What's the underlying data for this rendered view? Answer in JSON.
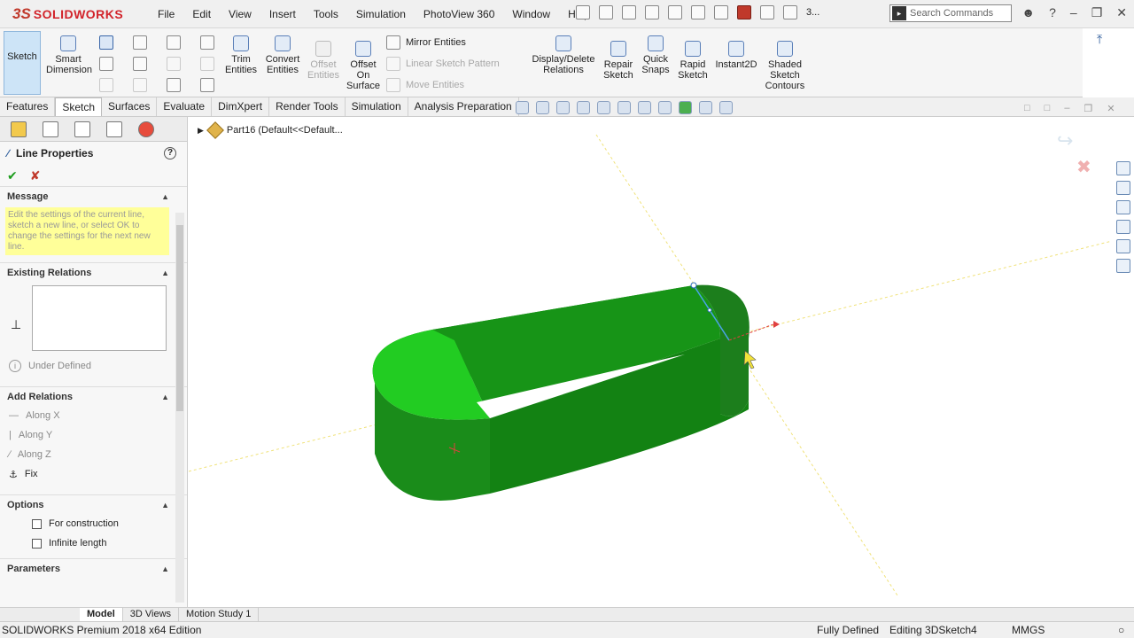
{
  "app": {
    "logo_text": "SOLIDWORKS",
    "menu": [
      "File",
      "Edit",
      "View",
      "Insert",
      "Tools",
      "Simulation",
      "PhotoView 360",
      "Window",
      "Help"
    ],
    "search_placeholder": "Search Commands",
    "toolbar_more": "3..."
  },
  "ribbon": {
    "sketch": "Sketch",
    "smart_dimension": "Smart Dimension",
    "trim_entities": "Trim Entities",
    "convert_entities": "Convert Entities",
    "offset_entities": "Offset Entities",
    "offset_on_surface": "Offset On Surface",
    "mirror_entities": "Mirror Entities",
    "linear_sketch_pattern": "Linear Sketch Pattern",
    "move_entities": "Move Entities",
    "display_delete_relations": "Display/Delete Relations",
    "repair_sketch": "Repair Sketch",
    "quick_snaps": "Quick Snaps",
    "rapid_sketch": "Rapid Sketch",
    "instant2d": "Instant2D",
    "shaded_sketch_contours": "Shaded Sketch Contours"
  },
  "tabs": [
    "Features",
    "Sketch",
    "Surfaces",
    "Evaluate",
    "DimXpert",
    "Render Tools",
    "Simulation",
    "Analysis Preparation"
  ],
  "active_tab": "Sketch",
  "pm": {
    "title": "Line Properties",
    "message_header": "Message",
    "message_text": "Edit the settings of the current line, sketch a new line, or select OK to change the settings for the next new line.",
    "existing_relations_header": "Existing Relations",
    "state": "Under Defined",
    "add_relations_header": "Add Relations",
    "relations": [
      "Along X",
      "Along Y",
      "Along Z",
      "Fix"
    ],
    "options_header": "Options",
    "opt_construction": "For construction",
    "opt_infinite": "Infinite length",
    "parameters_header": "Parameters"
  },
  "graphics": {
    "tree_label": "Part16  (Default<<Default...",
    "model_color": "#1a8c1a",
    "top_face_color": "#22cc22"
  },
  "bottom_tabs": [
    "Model",
    "3D Views",
    "Motion Study 1"
  ],
  "status": {
    "edition": "SOLIDWORKS Premium 2018 x64 Edition",
    "defined": "Fully Defined",
    "editing": "Editing 3DSketch4",
    "units": "MMGS"
  }
}
